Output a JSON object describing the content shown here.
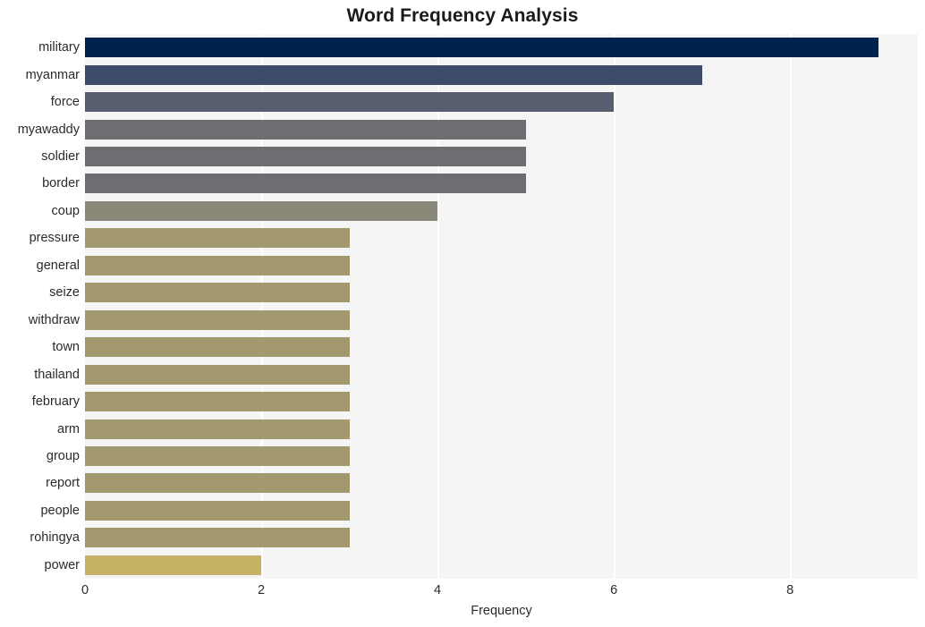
{
  "chart_data": {
    "type": "bar",
    "orientation": "horizontal",
    "title": "Word Frequency Analysis",
    "xlabel": "Frequency",
    "ylabel": "",
    "categories": [
      "military",
      "myanmar",
      "force",
      "myawaddy",
      "soldier",
      "border",
      "coup",
      "pressure",
      "general",
      "seize",
      "withdraw",
      "town",
      "thailand",
      "february",
      "arm",
      "group",
      "report",
      "people",
      "rohingya",
      "power"
    ],
    "values": [
      9,
      7,
      6,
      5,
      5,
      5,
      4,
      3,
      3,
      3,
      3,
      3,
      3,
      3,
      3,
      3,
      3,
      3,
      3,
      2
    ],
    "bar_colors": [
      "#00234d",
      "#3e4a6b",
      "#595d70",
      "#6c6e72",
      "#6d6e71",
      "#6d6e71",
      "#8a8878",
      "#a3996f",
      "#a3996f",
      "#a3996f",
      "#a3996f",
      "#a3996f",
      "#a3996f",
      "#a3996f",
      "#a3996f",
      "#a3996f",
      "#a3996f",
      "#a3996f",
      "#a3996f",
      "#c6b265"
    ],
    "xlim": [
      0,
      9.45
    ],
    "xticks": [
      0,
      2,
      4,
      6,
      8
    ],
    "xtick_labels": [
      "0",
      "2",
      "4",
      "6",
      "8"
    ],
    "grid": "vertical",
    "legend": "none",
    "plot_background": "#f5f5f6",
    "gridline_color": "#ffffff",
    "title_color": "#1a1a1a",
    "tick_label_color": "#2b2b2b"
  }
}
